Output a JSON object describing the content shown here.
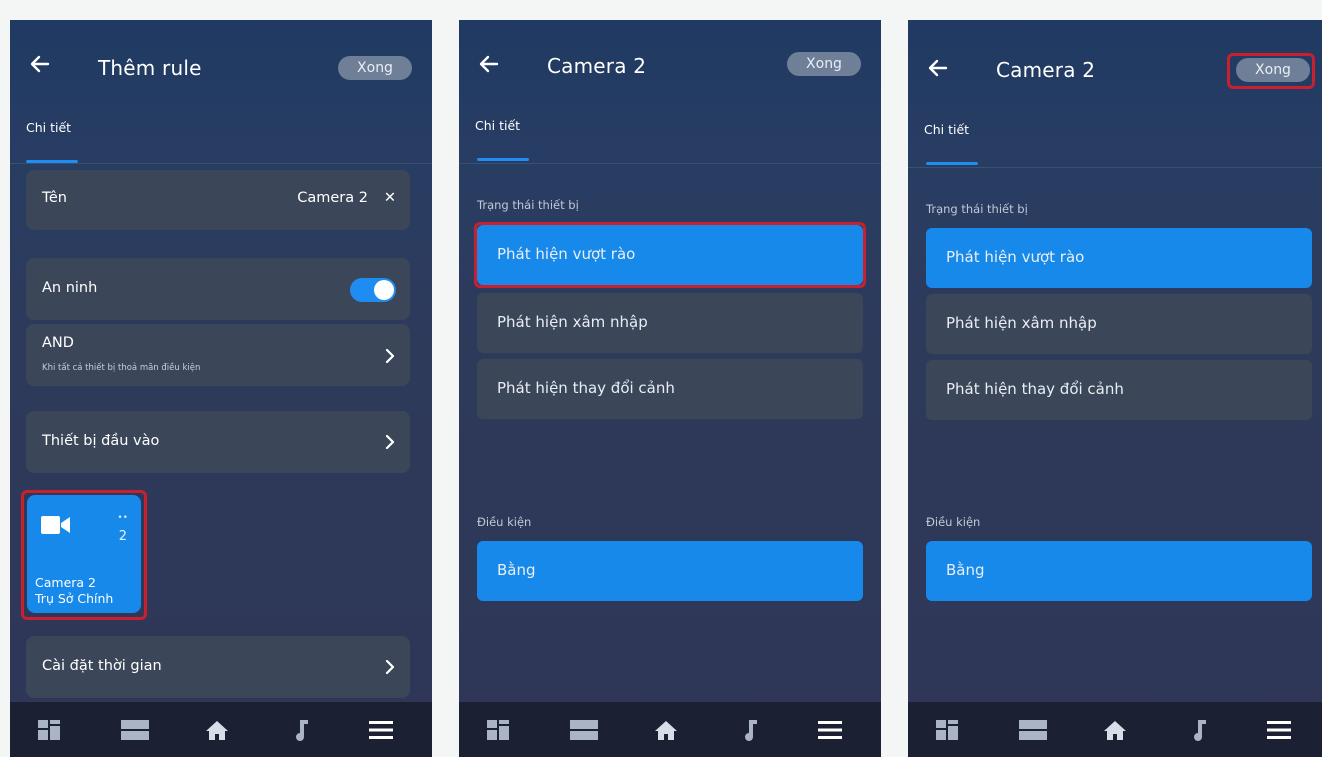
{
  "phone1": {
    "title": "Thêm rule",
    "done": "Xong",
    "tab": "Chi tiết",
    "name_label": "Tên",
    "name_value": "Camera 2",
    "name_clear": "✕",
    "security_label": "An ninh",
    "security_on": true,
    "logic_label": "AND",
    "logic_sub": "Khi tất cả thiết bị thoả mãn điều kiện",
    "input_devices": "Thiết bị đầu vào",
    "device": {
      "dots": "••",
      "num": "2",
      "name": "Camera 2",
      "location": "Trụ Sở Chính"
    },
    "time_settings": "Cài đặt thời gian"
  },
  "phone2": {
    "title": "Camera 2",
    "done": "Xong",
    "tab": "Chi tiết",
    "state_label": "Trạng thái thiết bị",
    "options": [
      "Phát hiện vượt rào",
      "Phát hiện xâm nhập",
      "Phát hiện thay đổi cảnh"
    ],
    "selected": 0,
    "condition_label": "Điều kiện",
    "condition_value": "Bằng"
  },
  "phone3": {
    "title": "Camera 2",
    "done": "Xong",
    "tab": "Chi tiết",
    "state_label": "Trạng thái thiết bị",
    "options": [
      "Phát hiện vượt rào",
      "Phát hiện xâm nhập",
      "Phát hiện thay đổi cảnh"
    ],
    "selected": 0,
    "condition_label": "Điều kiện",
    "condition_value": "Bằng"
  },
  "navbar": {
    "icons": [
      "dashboard-icon",
      "rooms-icon",
      "home-icon",
      "music-icon",
      "menu-icon"
    ]
  },
  "colors": {
    "accent": "#1689ea",
    "highlight": "#c8202e",
    "card": "#3b4658"
  }
}
